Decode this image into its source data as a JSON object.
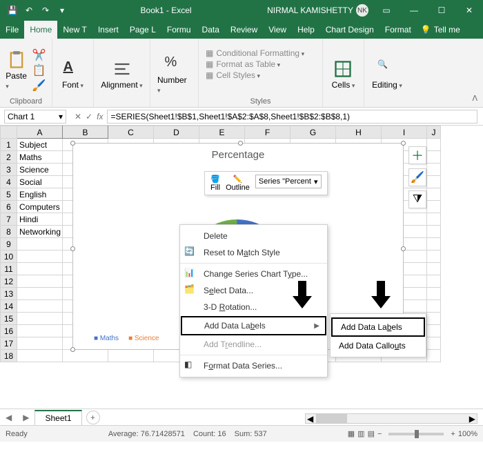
{
  "titlebar": {
    "title": "Book1 - Excel",
    "user_name": "NIRMAL KAMISHETTY",
    "user_initials": "NK"
  },
  "tabs": {
    "file": "File",
    "home": "Home",
    "newt": "New T",
    "insert": "Insert",
    "pagel": "Page L",
    "formu": "Formu",
    "data": "Data",
    "review": "Review",
    "view": "View",
    "help": "Help",
    "chartd": "Chart Design",
    "format": "Format",
    "tellme": "Tell me"
  },
  "ribbon_groups": {
    "clipboard": "Clipboard",
    "paste": "Paste",
    "font": "Font",
    "alignment": "Alignment",
    "number": "Number",
    "styles": "Styles",
    "cells": "Cells",
    "editing": "Editing",
    "cond_fmt": "Conditional Formatting",
    "fmt_table": "Format as Table",
    "cell_styles": "Cell Styles"
  },
  "namebox": {
    "value": "Chart 1"
  },
  "formula": {
    "value": "=SERIES(Sheet1!$B$1,Sheet1!$A$2:$A$8,Sheet1!$B$2:$B$8,1)"
  },
  "columns": [
    "A",
    "B",
    "C",
    "D",
    "E",
    "F",
    "G",
    "H",
    "I",
    "J"
  ],
  "rows": [
    "1",
    "2",
    "3",
    "4",
    "5",
    "6",
    "7",
    "8",
    "9",
    "10",
    "11",
    "12",
    "13",
    "14",
    "15",
    "16",
    "17",
    "18"
  ],
  "colA": [
    "Subject",
    "Maths",
    "Science",
    "Social",
    "English",
    "Computers",
    "Hindi",
    "Networking"
  ],
  "chart": {
    "title": "Percentage",
    "mini_fill": "Fill",
    "mini_outline": "Outline",
    "mini_series": "Series \"Percent",
    "legend": [
      "Maths",
      "Science"
    ]
  },
  "context": {
    "delete": "Delete",
    "reset": "Reset to Match Style",
    "change": "Change Series Chart Type...",
    "select": "Select Data...",
    "rot3d": "3-D Rotation...",
    "addlabels": "Add Data Labels",
    "addtrend": "Add Trendline...",
    "formatds": "Format Data Series..."
  },
  "submenu": {
    "addlabels": "Add Data Labels",
    "addcallouts": "Add Data Callouts"
  },
  "sheet_tabs": {
    "sheet1": "Sheet1"
  },
  "statusbar": {
    "ready": "Ready",
    "avg": "Average: 76.71428571",
    "count": "Count: 16",
    "sum": "Sum: 537",
    "zoom": "100%"
  },
  "chart_data": {
    "type": "pie",
    "title": "Percentage",
    "categories": [
      "Maths",
      "Science",
      "Social",
      "English",
      "Computers",
      "Hindi",
      "Networking"
    ],
    "note": "Slice values not visible in screenshot; only partial legend (Maths, Science) shown."
  }
}
